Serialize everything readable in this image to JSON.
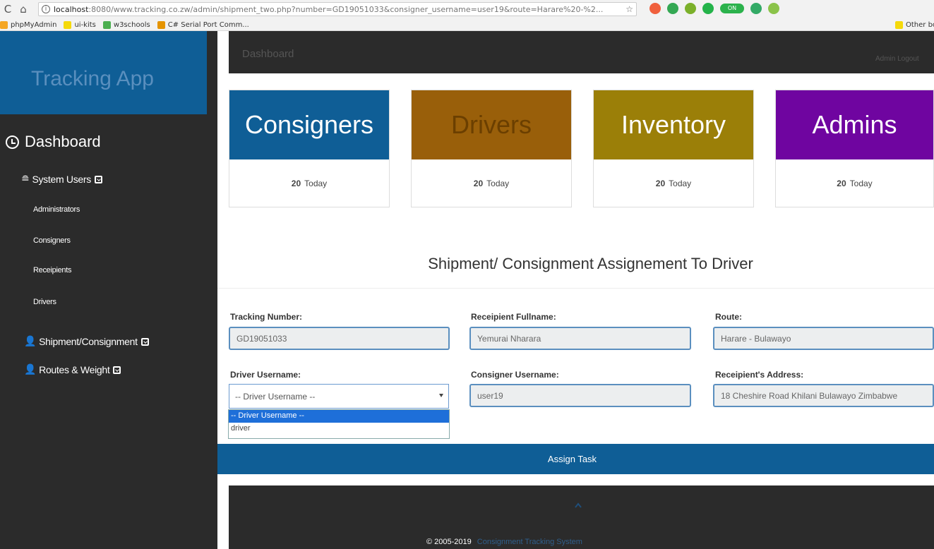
{
  "browser": {
    "url_host": "localhost",
    "url_rest": ":8080/www.tracking.co.zw/admin/shipment_two.php?number=GD1905103​3&consigner_username=user19&route=Harare%20-%2...",
    "extension_toggle": "ON",
    "bookmarks": [
      "phpMyAdmin",
      "ui-kits",
      "w3schools",
      "C# Serial Port Comm..."
    ],
    "other_bookmarks": "Other bo"
  },
  "sidebar": {
    "brand": "Tracking App",
    "dashboard": "Dashboard",
    "system_users": "System Users",
    "sub_items": [
      "Administrators",
      "Consigners",
      "Receipients",
      "Drivers"
    ],
    "shipment": "Shipment/Consignment",
    "routes": "Routes & Weight"
  },
  "topbar": {
    "dashboard": "Dashboard",
    "right_text": "Admin     Logout"
  },
  "cards": [
    {
      "title": "Consigners",
      "count": "20",
      "suffix": "Today",
      "color": "#0f5e96",
      "text_color": "#ffffff"
    },
    {
      "title": "Drivers",
      "count": "20",
      "suffix": "Today",
      "color": "#995f0a",
      "text_color": "#6b3f00"
    },
    {
      "title": "Inventory",
      "count": "20",
      "suffix": "Today",
      "color": "#9b7f08",
      "text_color": "#ffffff"
    },
    {
      "title": "Admins",
      "count": "20",
      "suffix": "Today",
      "color": "#6f05a0",
      "text_color": "#ffffff"
    }
  ],
  "form": {
    "title": "Shipment/ Consignment Assignement To Driver",
    "tracking_label": "Tracking Number:",
    "tracking_value": "GD19051033",
    "recipient_label": "Receipient Fullname:",
    "recipient_value": "Yemurai Nharara",
    "route_label": "Route:",
    "route_value": "Harare - Bulawayo",
    "driver_label": "Driver Username:",
    "driver_selected": "-- Driver Username --",
    "driver_options": [
      "-- Driver Username --",
      "driver"
    ],
    "consigner_label": "Consigner Username:",
    "consigner_value": "user19",
    "address_label": "Receipient's Address:",
    "address_value": "18 Cheshire Road Khilani Bulawayo Zimbabwe",
    "submit": "Assign Task"
  },
  "footer": {
    "copyright": "© 2005-2019",
    "link_text": "Consignment Tracking System"
  },
  "colors": {
    "brand_blue": "#0f5e96",
    "sidebar_bg": "#2b2b2b",
    "input_border": "#5b8fbf"
  }
}
